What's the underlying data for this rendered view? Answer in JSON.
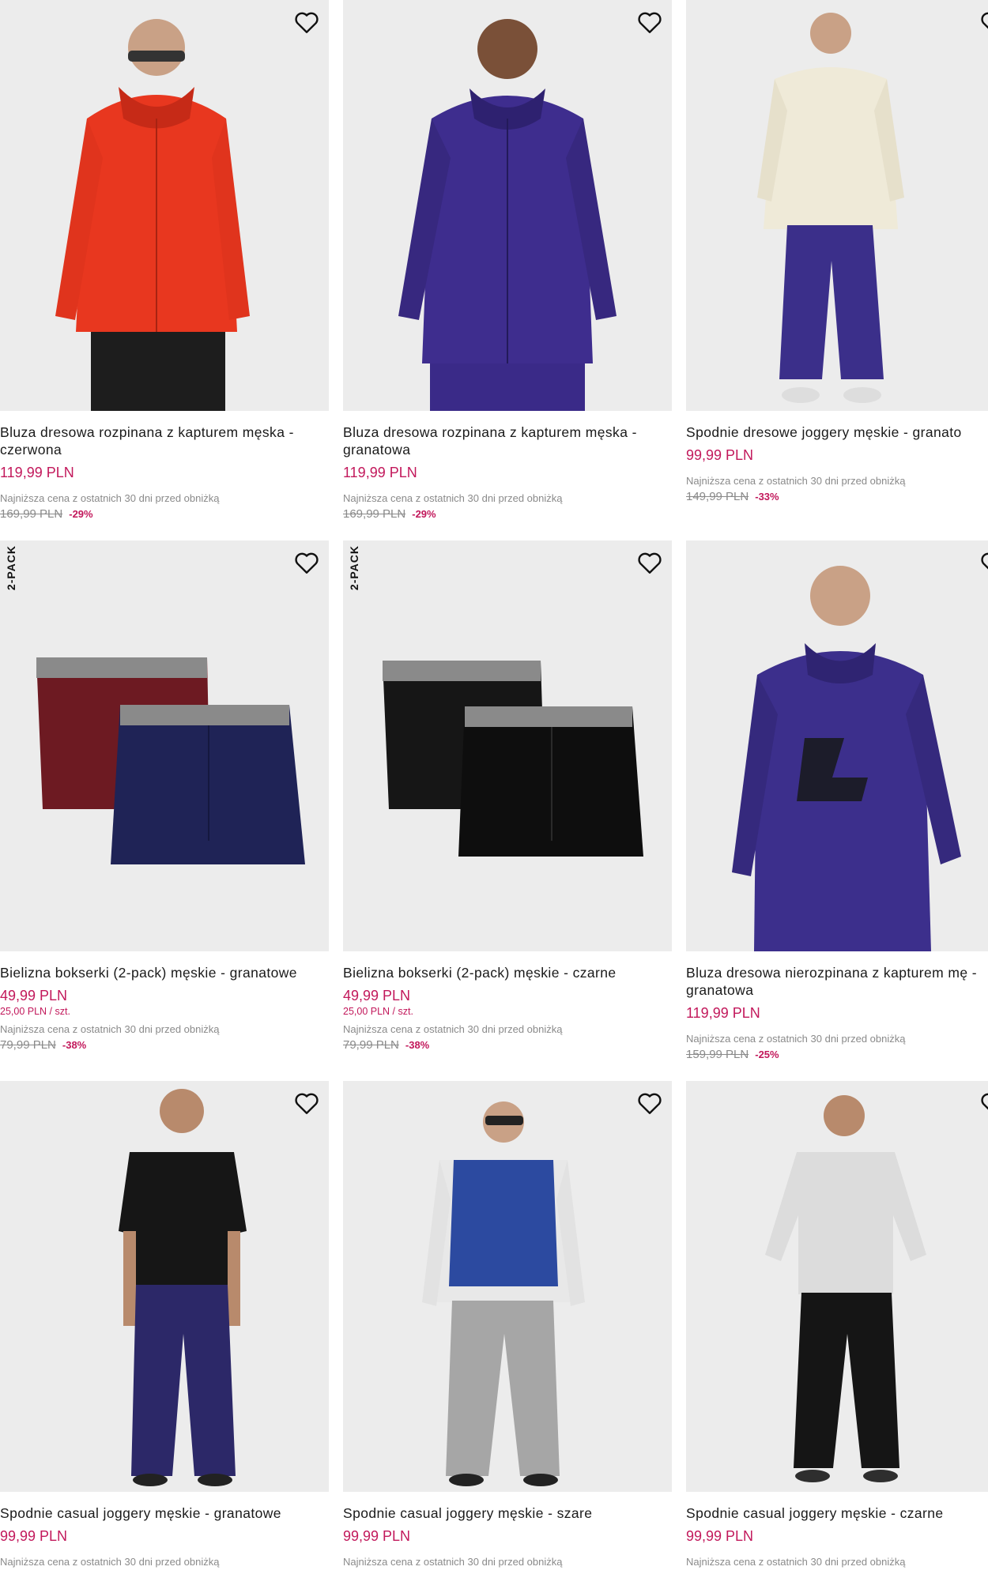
{
  "colors": {
    "accent": "#c2185b",
    "muted": "#8a8a8a",
    "image_bg": "#ececec"
  },
  "products": [
    {
      "name": "Bluza dresowa rozpinana z kapturem męska - czerwona",
      "price": "119,99 PLN",
      "lowest_note": "Najniższa cena z ostatnich 30 dni przed obniżką",
      "old_price": "169,99 PLN",
      "discount": "-29%",
      "badge": "",
      "unit_price": "",
      "wishlist_icon": "heart-outline-icon"
    },
    {
      "name": "Bluza dresowa rozpinana z kapturem męska - granatowa",
      "price": "119,99 PLN",
      "lowest_note": "Najniższa cena z ostatnich 30 dni przed obniżką",
      "old_price": "169,99 PLN",
      "discount": "-29%",
      "badge": "",
      "unit_price": "",
      "wishlist_icon": "heart-outline-icon"
    },
    {
      "name": "Spodnie dresowe joggery męskie - granato",
      "price": "99,99 PLN",
      "lowest_note": "Najniższa cena z ostatnich 30 dni przed obniżką",
      "old_price": "149,99 PLN",
      "discount": "-33%",
      "badge": "",
      "unit_price": "",
      "wishlist_icon": "heart-outline-icon"
    },
    {
      "name": "Bielizna bokserki (2-pack) męskie - granatowe",
      "price": "49,99 PLN",
      "lowest_note": "Najniższa cena z ostatnich 30 dni przed obniżką",
      "old_price": "79,99 PLN",
      "discount": "-38%",
      "badge": "2-PACK",
      "unit_price": "25,00 PLN / szt.",
      "wishlist_icon": "heart-outline-icon"
    },
    {
      "name": "Bielizna bokserki (2-pack) męskie - czarne",
      "price": "49,99 PLN",
      "lowest_note": "Najniższa cena z ostatnich 30 dni przed obniżką",
      "old_price": "79,99 PLN",
      "discount": "-38%",
      "badge": "2-PACK",
      "unit_price": "25,00 PLN / szt.",
      "wishlist_icon": "heart-outline-icon"
    },
    {
      "name": "Bluza dresowa nierozpinana z kapturem mę - granatowa",
      "price": "119,99 PLN",
      "lowest_note": "Najniższa cena z ostatnich 30 dni przed obniżką",
      "old_price": "159,99 PLN",
      "discount": "-25%",
      "badge": "",
      "unit_price": "",
      "wishlist_icon": "heart-outline-icon"
    },
    {
      "name": "Spodnie casual joggery męskie - granatowe",
      "price": "99,99 PLN",
      "lowest_note": "Najniższa cena z ostatnich 30 dni przed obniżką",
      "old_price": "",
      "discount": "",
      "badge": "",
      "unit_price": "",
      "wishlist_icon": "heart-outline-icon"
    },
    {
      "name": "Spodnie casual joggery męskie - szare",
      "price": "99,99 PLN",
      "lowest_note": "Najniższa cena z ostatnich 30 dni przed obniżką",
      "old_price": "",
      "discount": "",
      "badge": "",
      "unit_price": "",
      "wishlist_icon": "heart-outline-icon"
    },
    {
      "name": "Spodnie casual joggery męskie - czarne",
      "price": "99,99 PLN",
      "lowest_note": "Najniższa cena z ostatnich 30 dni przed obniżką",
      "old_price": "",
      "discount": "",
      "badge": "",
      "unit_price": "",
      "wishlist_icon": "heart-outline-icon"
    }
  ]
}
